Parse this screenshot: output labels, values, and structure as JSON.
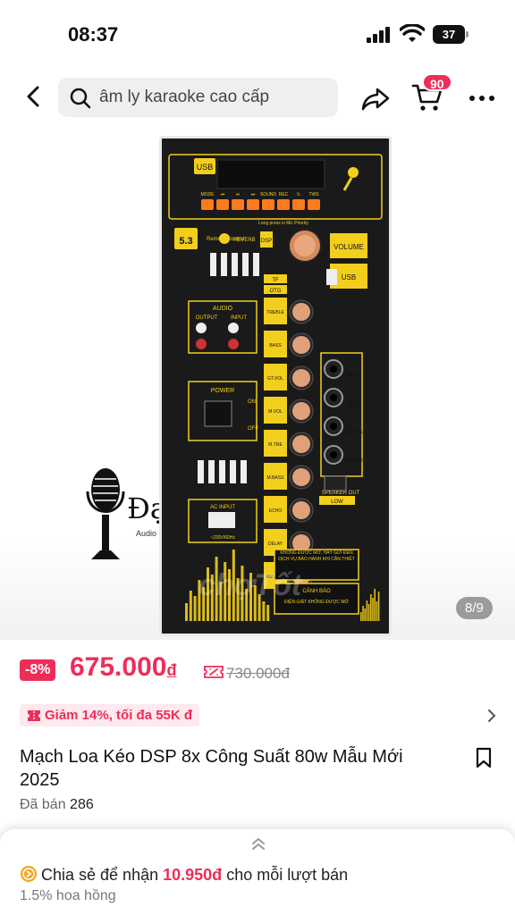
{
  "status_bar": {
    "time": "08:37",
    "battery": "37"
  },
  "header": {
    "search_query": "âm ly karaoke cao cấp",
    "cart_count": "90"
  },
  "gallery": {
    "counter": "8/9",
    "brand": "Đạt",
    "brand_sub": "Audio",
    "watermark": "chợTốt"
  },
  "board": {
    "usb_label": "USB",
    "top_buttons": [
      "MODE",
      "⏮",
      "⏯",
      "⏭",
      "SOUND",
      "REC",
      "↻",
      "TWS"
    ],
    "bluetooth": "5.3",
    "remote": "Remote Control",
    "reverb": "REVERB",
    "dsp": "DSP",
    "long_press": "Long press is Mic Priority",
    "volume": "VOLUME",
    "usb_port": "USB",
    "audio": "AUDIO",
    "output": "OUTPUT",
    "input": "INPUT",
    "power": "POWER",
    "on": "ON",
    "off": "OFF",
    "ac_input": "AC INPUT",
    "ac_voltage": "~220V/60Hz",
    "knobs": [
      "TREBLE",
      "BASS",
      "GT.VOL",
      "M.VOL",
      "M.TRE",
      "M.BASS",
      "ECHO",
      "DELAY",
      "REVERB"
    ],
    "tf": "TF",
    "otg": "OTG",
    "mic_labels": [
      "MIC1",
      "MIC2",
      "GUITAR1",
      "GUITAR2"
    ],
    "speaker_out": "SPEAKER OUT",
    "low": "LOW",
    "warning1": "KHÔNG ĐƯỢC MỞ, HÃY GỬI ĐẾN DỊCH VỤ BẢO HÀNH KHI CẦN THIẾT",
    "warning2": "CẢNH BÁO",
    "warning3": "ĐIỆN GIẬT KHÔNG ĐƯỢC MỞ",
    "accent": "#f2cf1c",
    "orange": "#ff7a1a"
  },
  "price": {
    "discount": "-8%",
    "current": "675.000",
    "currency": "đ",
    "original": "730.000đ"
  },
  "promo": {
    "text": "Giảm 14%, tối đa 55K đ"
  },
  "product": {
    "title": "Mạch Loa Kéo DSP 8x Công Suất 80w Mẫu Mới 2025",
    "sold_label": "Đã bán",
    "sold_count": "286"
  },
  "affiliate": {
    "prefix": "Chia sẻ để nhận",
    "amount": "10.950đ",
    "suffix": "cho mỗi lượt bán",
    "commission": "1.5% hoa hồng"
  },
  "colors": {
    "brand": "#ee2d59",
    "board_bg": "#1a1a1a"
  }
}
